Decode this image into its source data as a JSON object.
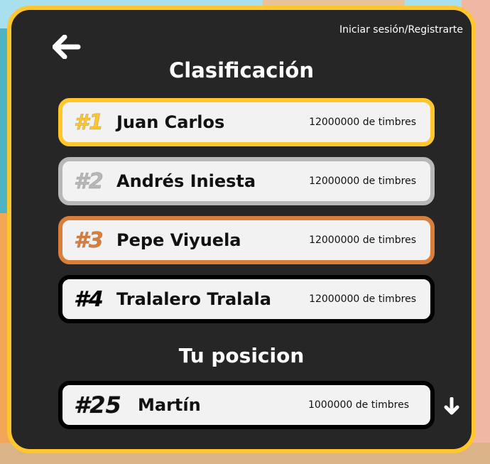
{
  "header": {
    "login_label": "Iniciar sesión/Registrarte",
    "title": "Clasificación"
  },
  "leaderboard": [
    {
      "rank": "#1",
      "name": "Juan Carlos",
      "score": "12000000 de timbres",
      "color": "#ffc62e"
    },
    {
      "rank": "#2",
      "name": "Andrés Iniesta",
      "score": "12000000 de timbres",
      "color": "#b8b8b8"
    },
    {
      "rank": "#3",
      "name": "Pepe Viyuela",
      "score": "12000000 de timbres",
      "color": "#d97f3c"
    },
    {
      "rank": "#4",
      "name": "Tralalero Tralala",
      "score": "12000000 de timbres",
      "color": "#000000"
    }
  ],
  "my_position": {
    "heading": "Tu posicion",
    "rank": "#25",
    "name": "Martín",
    "score": "1000000 de timbres"
  },
  "icons": {
    "back": "arrow-left-icon",
    "scroll": "arrow-down-icon"
  },
  "colors": {
    "panel_bg": "#262626",
    "panel_border": "#ffc62e",
    "card_bg": "#f2f2f2"
  }
}
